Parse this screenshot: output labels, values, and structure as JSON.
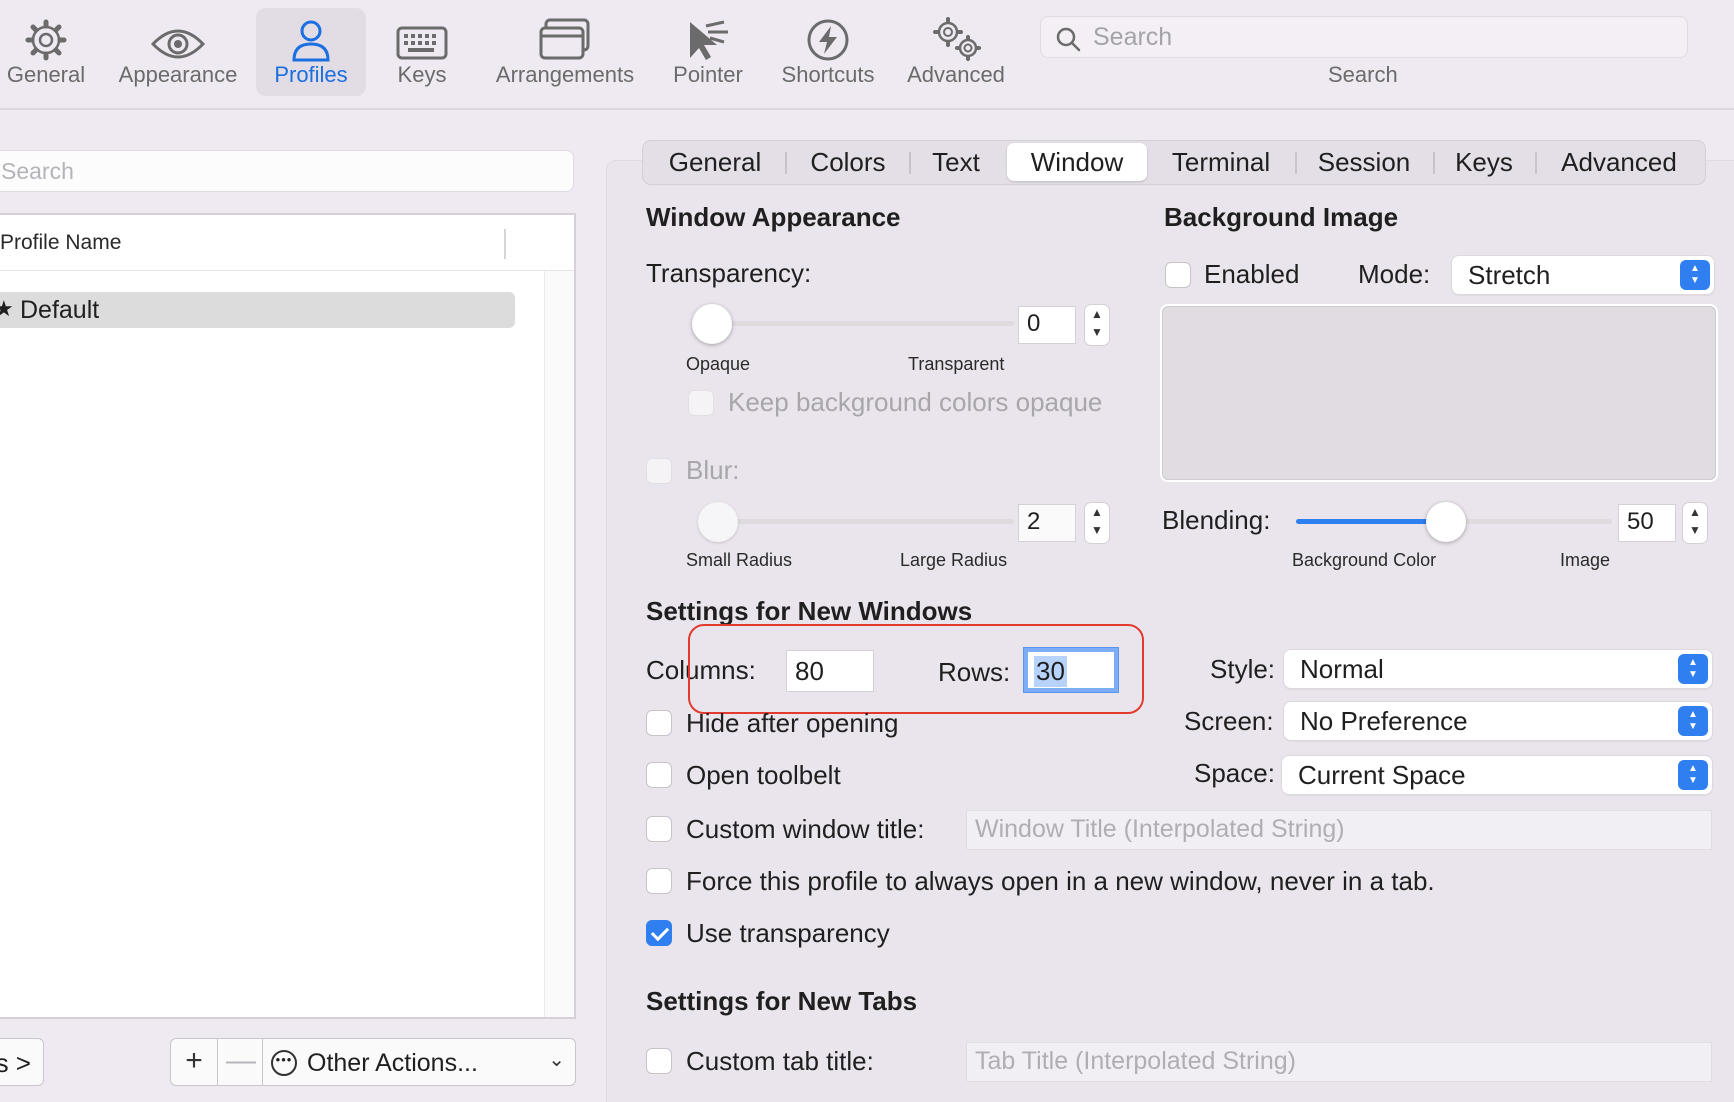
{
  "toolbar": {
    "items": [
      {
        "label": "General",
        "icon": "gear-icon"
      },
      {
        "label": "Appearance",
        "icon": "eye-icon"
      },
      {
        "label": "Profiles",
        "icon": "person-icon"
      },
      {
        "label": "Keys",
        "icon": "keyboard-icon"
      },
      {
        "label": "Arrangements",
        "icon": "window-arrangement-icon"
      },
      {
        "label": "Pointer",
        "icon": "pointer-icon"
      },
      {
        "label": "Shortcuts",
        "icon": "lightning-icon"
      },
      {
        "label": "Advanced",
        "icon": "gears-icon"
      }
    ],
    "active": "Profiles",
    "search_placeholder": "Search",
    "search_caption": "Search"
  },
  "profiles": {
    "search_placeholder": "Search",
    "column_header": "Profile Name",
    "items": [
      {
        "name": "Default",
        "default": true
      }
    ],
    "tags_button": "s >",
    "add_button": "+",
    "remove_button": "—",
    "other_actions": "Other Actions..."
  },
  "tabs": [
    "General",
    "Colors",
    "Text",
    "Window",
    "Terminal",
    "Session",
    "Keys",
    "Advanced"
  ],
  "active_tab": "Window",
  "window_appearance": {
    "title": "Window Appearance",
    "transparency_label": "Transparency:",
    "transparency_value": "0",
    "transparency_min_label": "Opaque",
    "transparency_max_label": "Transparent",
    "keep_bg_opaque_label": "Keep background colors opaque",
    "blur_label": "Blur:",
    "blur_value": "2",
    "blur_min_label": "Small Radius",
    "blur_max_label": "Large Radius"
  },
  "background_image": {
    "title": "Background Image",
    "enabled_label": "Enabled",
    "mode_label": "Mode:",
    "mode_value": "Stretch",
    "blending_label": "Blending:",
    "blending_value": "50",
    "blending_min_label": "Background Color",
    "blending_max_label": "Image"
  },
  "new_windows": {
    "title": "Settings for New Windows",
    "columns_label": "Columns:",
    "columns_value": "80",
    "rows_label": "Rows:",
    "rows_value": "30",
    "style_label": "Style:",
    "style_value": "Normal",
    "screen_label": "Screen:",
    "screen_value": "No Preference",
    "space_label": "Space:",
    "space_value": "Current Space",
    "hide_after_opening": "Hide after opening",
    "open_toolbelt": "Open toolbelt",
    "custom_window_title": "Custom window title:",
    "window_title_placeholder": "Window Title (Interpolated String)",
    "force_new_window": "Force this profile to always open in a new window, never in a tab.",
    "use_transparency": "Use transparency",
    "use_transparency_checked": true
  },
  "new_tabs": {
    "title": "Settings for New Tabs",
    "custom_tab_title": "Custom tab title:",
    "tab_title_placeholder": "Tab Title (Interpolated String)"
  },
  "colors": {
    "accent": "#2f7ff0",
    "highlight_annotation": "#e23b2e",
    "active_toolbar": "#1b6fe0"
  }
}
